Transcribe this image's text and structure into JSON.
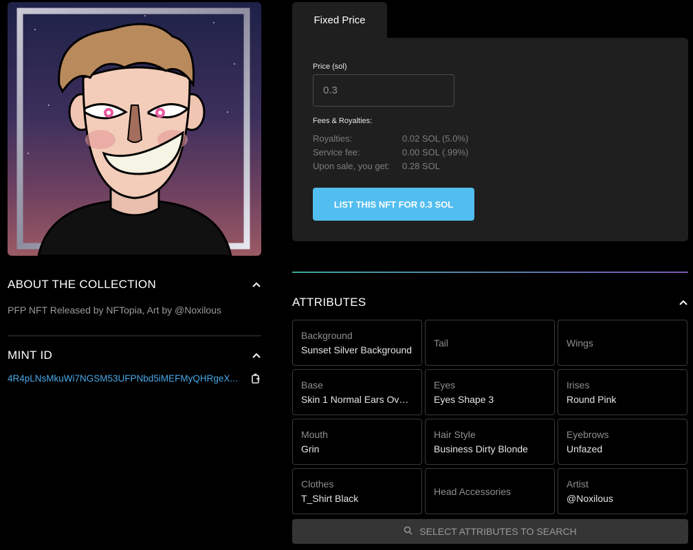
{
  "collection": {
    "heading": "ABOUT THE COLLECTION",
    "description": "PFP NFT Released by NFTopia, Art by @Noxilous"
  },
  "mint": {
    "heading": "MINT ID",
    "id": "4R4pLNsMkuWi7NGSM53UFPNbd5iMEFMyQHRgeX..."
  },
  "listing": {
    "tab_label": "Fixed Price",
    "price_label": "Price (sol)",
    "price_value": "0.3",
    "fees_title": "Fees & Royalties:",
    "fees": [
      {
        "label": "Royalties:",
        "value": "0.02 SOL (5.0%)"
      },
      {
        "label": "Service fee:",
        "value": "0.00 SOL (.99%)"
      },
      {
        "label": "Upon sale, you get:",
        "value": "0.28 SOL"
      }
    ],
    "button_label": "LIST THIS NFT FOR 0.3 SOL"
  },
  "attributes": {
    "heading": "ATTRIBUTES",
    "items": [
      {
        "name": "Background",
        "value": "Sunset Silver Background"
      },
      {
        "name": "Tail",
        "value": ""
      },
      {
        "name": "Wings",
        "value": ""
      },
      {
        "name": "Base",
        "value": "Skin 1 Normal Ears Oval..."
      },
      {
        "name": "Eyes",
        "value": "Eyes Shape 3"
      },
      {
        "name": "Irises",
        "value": "Round Pink"
      },
      {
        "name": "Mouth",
        "value": "Grin"
      },
      {
        "name": "Hair Style",
        "value": "Business Dirty Blonde"
      },
      {
        "name": "Eyebrows",
        "value": "Unfazed"
      },
      {
        "name": "Clothes",
        "value": "T_Shirt Black"
      },
      {
        "name": "Head Accessories",
        "value": ""
      },
      {
        "name": "Artist",
        "value": "@Noxilous"
      }
    ],
    "search_button_label": "SELECT ATTRIBUTES TO SEARCH"
  },
  "colors": {
    "accent_button": "#52bdef",
    "link": "#4aa8e8",
    "card_bg": "#1f1f1f",
    "page_bg": "#000000"
  },
  "icons": [
    "chevron-up-icon",
    "copy-icon",
    "search-icon"
  ]
}
